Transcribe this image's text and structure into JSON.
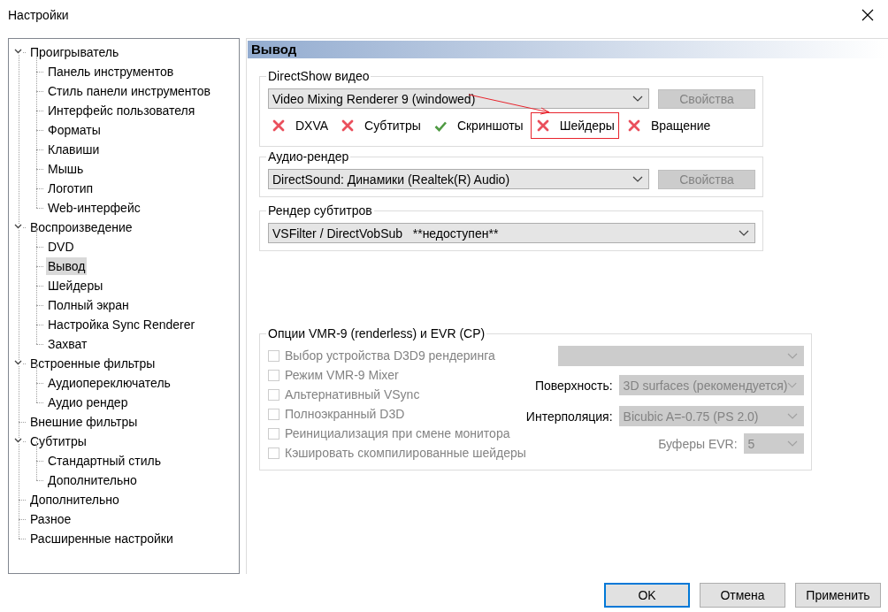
{
  "window": {
    "title": "Настройки"
  },
  "tree": [
    {
      "label": "Проигрыватель",
      "selected": false,
      "expanded": true,
      "children": [
        {
          "label": "Панель инструментов",
          "selected": false
        },
        {
          "label": "Стиль панели инструментов",
          "selected": false
        },
        {
          "label": "Интерфейс пользователя",
          "selected": false
        },
        {
          "label": "Форматы",
          "selected": false
        },
        {
          "label": "Клавиши",
          "selected": false
        },
        {
          "label": "Мышь",
          "selected": false
        },
        {
          "label": "Логотип",
          "selected": false
        },
        {
          "label": "Web-интерфейс",
          "selected": false
        }
      ]
    },
    {
      "label": "Воспроизведение",
      "selected": false,
      "expanded": true,
      "children": [
        {
          "label": "DVD",
          "selected": false
        },
        {
          "label": "Вывод",
          "selected": true
        },
        {
          "label": "Шейдеры",
          "selected": false
        },
        {
          "label": "Полный экран",
          "selected": false
        },
        {
          "label": "Настройка Sync Renderer",
          "selected": false
        },
        {
          "label": "Захват",
          "selected": false
        }
      ]
    },
    {
      "label": "Встроенные фильтры",
      "selected": false,
      "expanded": true,
      "children": [
        {
          "label": "Аудиопереключатель",
          "selected": false
        },
        {
          "label": "Аудио рендер",
          "selected": false
        }
      ]
    },
    {
      "label": "Внешние фильтры",
      "selected": false
    },
    {
      "label": "Субтитры",
      "selected": false,
      "expanded": true,
      "children": [
        {
          "label": "Стандартный стиль",
          "selected": false
        },
        {
          "label": "Дополнительно",
          "selected": false
        }
      ]
    },
    {
      "label": "Дополнительно",
      "selected": false
    },
    {
      "label": "Разное",
      "selected": false
    },
    {
      "label": "Расширенные настройки",
      "selected": false
    }
  ],
  "page": {
    "title": "Вывод",
    "directshow_video": {
      "label": "DirectShow видео",
      "renderer": {
        "value": "Video Mixing Renderer 9 (windowed)",
        "disabled": false
      },
      "properties_button": {
        "label": "Свойства",
        "disabled": true
      },
      "capabilities": [
        {
          "label": "DXVA",
          "supported": false,
          "highlighted": false
        },
        {
          "label": "Субтитры",
          "supported": false,
          "highlighted": false
        },
        {
          "label": "Скриншоты",
          "supported": true,
          "highlighted": false
        },
        {
          "label": "Шейдеры",
          "supported": false,
          "highlighted": true
        },
        {
          "label": "Вращение",
          "supported": false,
          "highlighted": false
        }
      ]
    },
    "audio_renderer": {
      "label": "Аудио-рендер",
      "renderer": {
        "value": "DirectSound: Динамики (Realtek(R) Audio)",
        "disabled": false
      },
      "properties_button": {
        "label": "Свойства",
        "disabled": true
      }
    },
    "subtitle_renderer": {
      "label": "Рендер субтитров",
      "renderer": {
        "value": "VSFilter / DirectVobSub   **недоступен**",
        "disabled": false
      }
    },
    "vmr_options": {
      "label": "Опции VMR-9 (renderless) и EVR (CP)",
      "checkboxes": [
        {
          "label": "Выбор устройства D3D9 рендеринга",
          "checked": false,
          "disabled": true
        },
        {
          "label": "Режим VMR-9 Mixer",
          "checked": false,
          "disabled": true
        },
        {
          "label": "Альтернативный VSync",
          "checked": false,
          "disabled": true
        },
        {
          "label": "Полноэкранный D3D",
          "checked": false,
          "disabled": true
        },
        {
          "label": "Реинициализация при смене монитора",
          "checked": false,
          "disabled": true
        },
        {
          "label": "Кэшировать скомпилированные шейдеры",
          "checked": false,
          "disabled": true
        }
      ],
      "fields": [
        {
          "kind": "device",
          "disabled": true
        },
        {
          "kind": "surface",
          "label": "Поверхность:",
          "label_disabled": false,
          "value": "3D surfaces (рекомендуется)",
          "disabled": true
        },
        {
          "kind": "interpolation",
          "label": "Интерполяция:",
          "label_disabled": false,
          "value": "Bicubic A=-0.75 (PS 2.0)",
          "disabled": true
        },
        {
          "kind": "buffers",
          "label": "Буферы EVR:",
          "label_disabled": true,
          "value": "5",
          "disabled": true
        }
      ]
    }
  },
  "buttons": [
    {
      "label": "OK",
      "default": true
    },
    {
      "label": "Отмена",
      "default": false
    },
    {
      "label": "Применить",
      "default": false
    }
  ]
}
